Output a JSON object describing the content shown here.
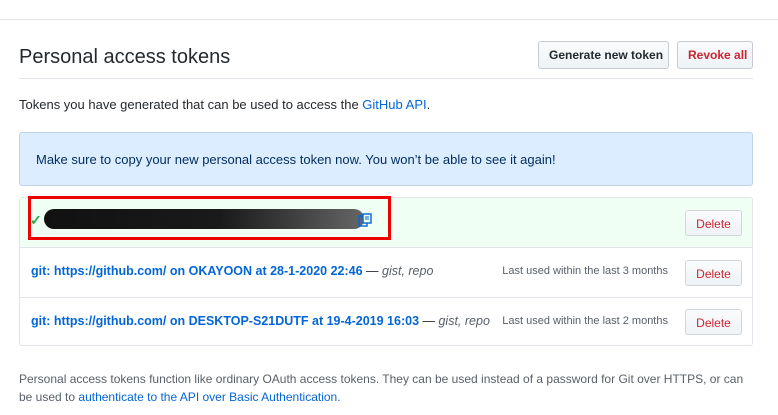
{
  "header": {
    "title": "Personal access tokens",
    "generate_label": "Generate new token",
    "revoke_label": "Revoke all"
  },
  "intro": {
    "text": "Tokens you have generated that can be used to access the ",
    "link": "GitHub API",
    "end": "."
  },
  "flash": {
    "message": "Make sure to copy your new personal access token now. You won’t be able to see it again!"
  },
  "tokens": [
    {
      "note": "",
      "scopes": "",
      "last_used": "",
      "delete_label": "Delete"
    },
    {
      "note": "git: https://github.com/ on OKAYOON at 28-1-2020 22:46",
      "sep": " — ",
      "scopes": "gist, repo",
      "last_used": "Last used within the last 3 months",
      "delete_label": "Delete"
    },
    {
      "note": "git: https://github.com/ on DESKTOP-S21DUTF at 19-4-2019 16:03",
      "sep": " — ",
      "scopes": "gist, repo",
      "last_used": "Last used within the last 2 months",
      "delete_label": "Delete"
    }
  ],
  "footer": {
    "text": "Personal access tokens function like ordinary OAuth access tokens. They can be used instead of a password for Git over HTTPS, or can be used to ",
    "link": "authenticate to the API over Basic Authentication",
    "end": "."
  },
  "colors": {
    "link": "#0366d6",
    "danger": "#cb2431",
    "success": "#28a745",
    "flash_bg": "#dbedff",
    "new_token_bg": "#f0fff4",
    "annotation_red": "#ee0000"
  }
}
